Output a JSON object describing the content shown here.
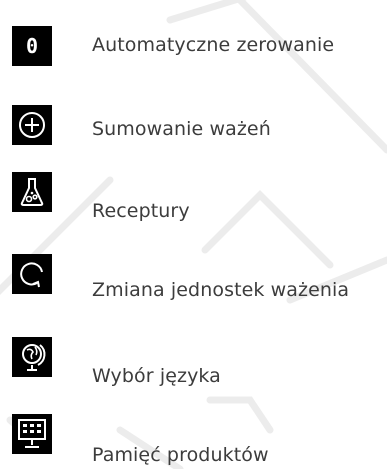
{
  "colors": {
    "icon_bg": "#000000",
    "icon_fg": "#ffffff",
    "text": "#3c3c3c",
    "watermark": "#e9e9e9"
  },
  "features": [
    {
      "icon": "zero-icon",
      "icon_glyph": "0",
      "label": "Automatyczne zerowanie"
    },
    {
      "icon": "plus-circle-icon",
      "label": "Sumowanie ważeń"
    },
    {
      "icon": "flask-icon",
      "label": "Receptury"
    },
    {
      "icon": "refresh-icon",
      "label": "Zmiana jednostek ważenia"
    },
    {
      "icon": "globe-icon",
      "label": "Wybór języka"
    },
    {
      "icon": "memory-keypad-icon",
      "label": "Pamięć produktów"
    }
  ]
}
